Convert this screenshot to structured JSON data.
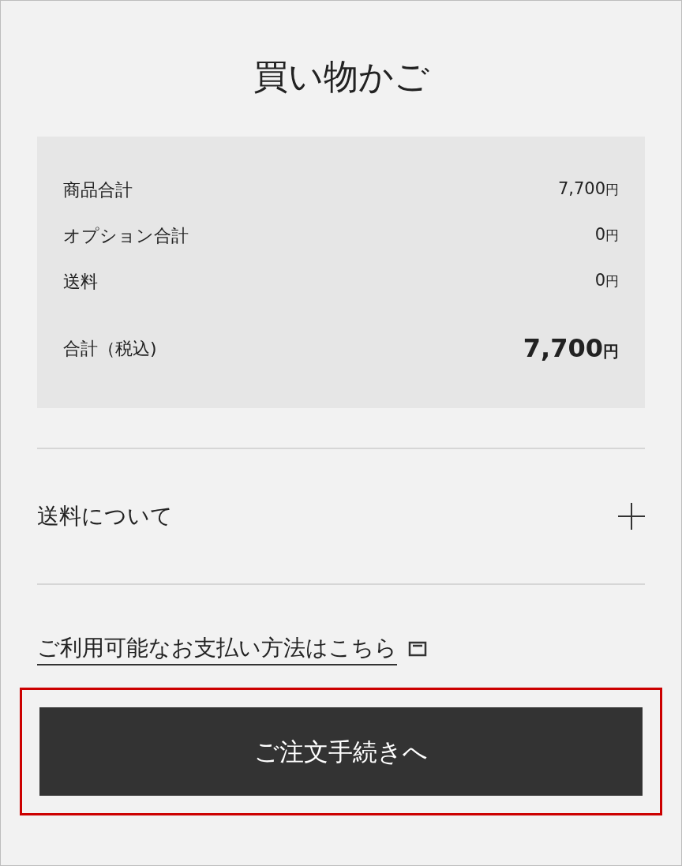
{
  "title": "買い物かご",
  "summary": {
    "rows": [
      {
        "label": "商品合計",
        "amount": "7,700",
        "unit": "円",
        "kind": "line"
      },
      {
        "label": "オプション合計",
        "amount": "0",
        "unit": "円",
        "kind": "line"
      },
      {
        "label": "送料",
        "amount": "0",
        "unit": "円",
        "kind": "line"
      },
      {
        "label": "合計（税込)",
        "amount": "7,700",
        "unit": "円",
        "kind": "total"
      }
    ]
  },
  "accordion": {
    "label": "送料について",
    "expanded": false
  },
  "payment_link": {
    "label": "ご利用可能なお支払い方法はこちら"
  },
  "checkout_button": {
    "label": "ご注文手続きへ",
    "highlighted": true
  }
}
